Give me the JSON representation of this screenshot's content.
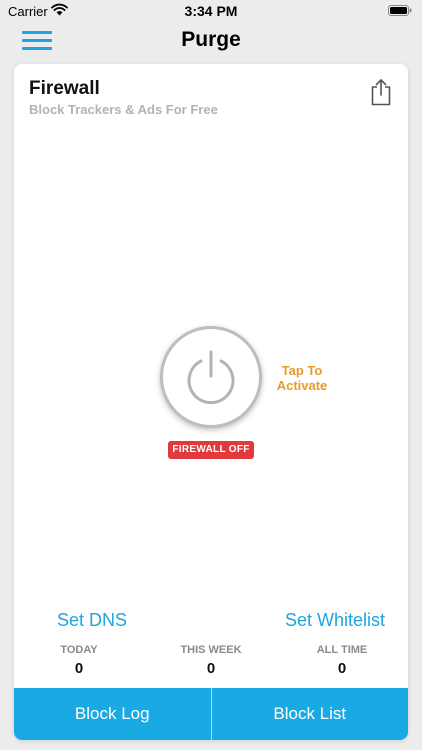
{
  "status_bar": {
    "carrier": "Carrier",
    "time": "3:34 PM",
    "wifi_icon": "wifi-icon",
    "battery_icon": "battery-icon"
  },
  "nav": {
    "title": "Purge",
    "menu_icon": "hamburger-menu-icon",
    "accent_color": "#1ca6dd"
  },
  "card": {
    "title": "Firewall",
    "subtitle": "Block Trackers & Ads For Free",
    "share_icon": "share-icon"
  },
  "power": {
    "icon": "power-icon",
    "tap_label_line1": "Tap To",
    "tap_label_line2": "Activate",
    "tap_label_color": "#e89a2a",
    "status_badge": "FIREWALL OFF",
    "status_badge_color": "#e0393e"
  },
  "actions": {
    "set_dns": "Set DNS",
    "set_whitelist": "Set Whitelist"
  },
  "stats": [
    {
      "label": "TODAY",
      "value": "0"
    },
    {
      "label": "THIS WEEK",
      "value": "0"
    },
    {
      "label": "ALL TIME",
      "value": "0"
    }
  ],
  "bottom_bar": {
    "block_log": "Block Log",
    "block_list": "Block List",
    "color": "#19a9e3"
  }
}
